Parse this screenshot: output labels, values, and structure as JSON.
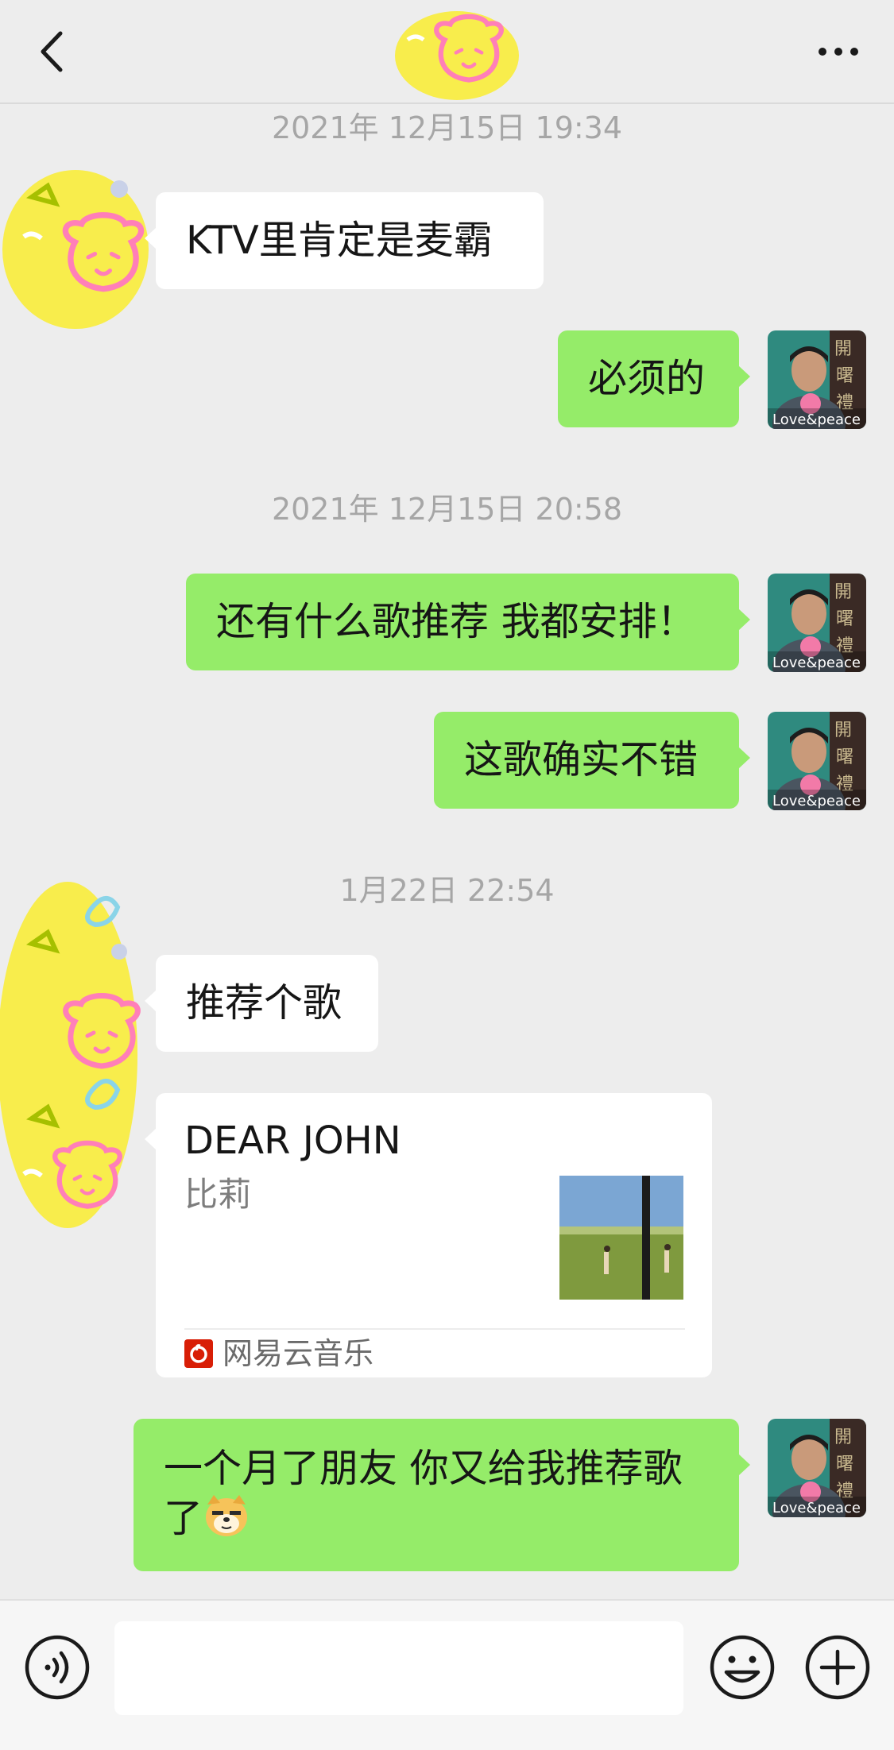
{
  "header": {
    "title": "",
    "back_icon": "chevron-left-icon",
    "more_icon": "more-horizontal-icon"
  },
  "messages": [
    {
      "type": "timestamp",
      "text": "2021年 12月15日 19:34"
    },
    {
      "type": "text",
      "side": "left",
      "text": "KTV里肯定是麦霸"
    },
    {
      "type": "text",
      "side": "right",
      "text": "必须的"
    },
    {
      "type": "timestamp",
      "text": "2021年 12月15日 20:58"
    },
    {
      "type": "text",
      "side": "right",
      "text": "还有什么歌推荐 我都安排！"
    },
    {
      "type": "text",
      "side": "right",
      "text": "这歌确实不错"
    },
    {
      "type": "timestamp",
      "text": "1月22日 22:54"
    },
    {
      "type": "text",
      "side": "left",
      "text": "推荐个歌"
    },
    {
      "type": "music",
      "side": "left",
      "title": "DEAR JOHN",
      "artist": "比莉",
      "source": "网易云音乐"
    },
    {
      "type": "text",
      "side": "right",
      "text": "一个月了朋友 你又给我推荐歌了",
      "emoji": "doge-emoji-icon"
    }
  ],
  "avatars": {
    "self_caption": "Love&peace"
  },
  "input_bar": {
    "placeholder": "",
    "voice_icon": "voice-icon",
    "emoji_icon": "emoji-icon",
    "plus_icon": "plus-icon"
  },
  "colors": {
    "background": "#ededed",
    "self_bubble": "#95ec69",
    "other_bubble": "#ffffff",
    "timestamp_text": "#a6a6a6",
    "netease_red": "#d81e06"
  }
}
